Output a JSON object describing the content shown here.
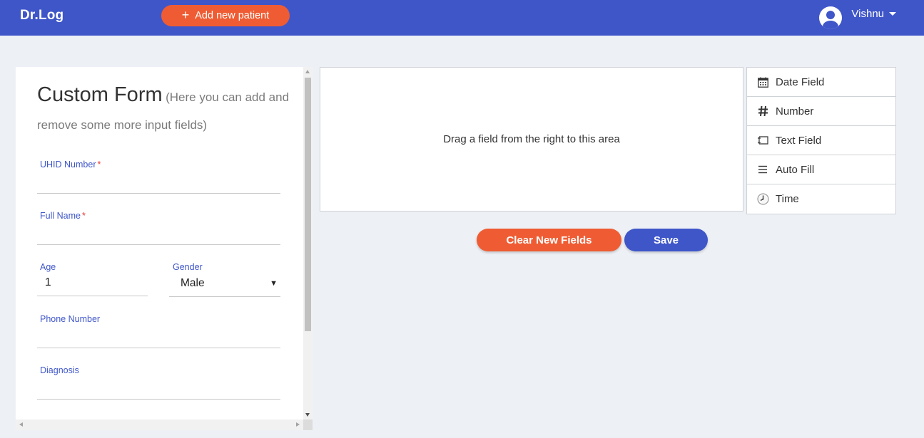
{
  "app": {
    "brand": "Dr.Log",
    "add_patient_label": "Add new patient",
    "user_name": "Vishnu"
  },
  "form": {
    "title": "Custom Form",
    "subtitle": "(Here you can add and remove some more input fields)",
    "fields": {
      "uhid": {
        "label": "UHID Number",
        "required_mark": "*",
        "value": ""
      },
      "full_name": {
        "label": "Full Name",
        "required_mark": "*",
        "value": ""
      },
      "age": {
        "label": "Age",
        "value": "1"
      },
      "gender": {
        "label": "Gender",
        "value": "Male"
      },
      "phone": {
        "label": "Phone Number",
        "value": ""
      },
      "diagnosis": {
        "label": "Diagnosis",
        "value": ""
      }
    }
  },
  "dropzone": {
    "text": "Drag a field from the right to this area"
  },
  "palette": {
    "items": [
      {
        "label": "Date Field",
        "icon": "calendar-icon"
      },
      {
        "label": "Number",
        "icon": "hash-icon"
      },
      {
        "label": "Text Field",
        "icon": "text-field-icon"
      },
      {
        "label": "Auto Fill",
        "icon": "list-icon"
      },
      {
        "label": "Time",
        "icon": "clock-icon"
      }
    ]
  },
  "actions": {
    "clear_label": "Clear New Fields",
    "save_label": "Save"
  },
  "colors": {
    "primary": "#3f56c9",
    "accent": "#ef5c33",
    "background": "#edf0f5"
  }
}
